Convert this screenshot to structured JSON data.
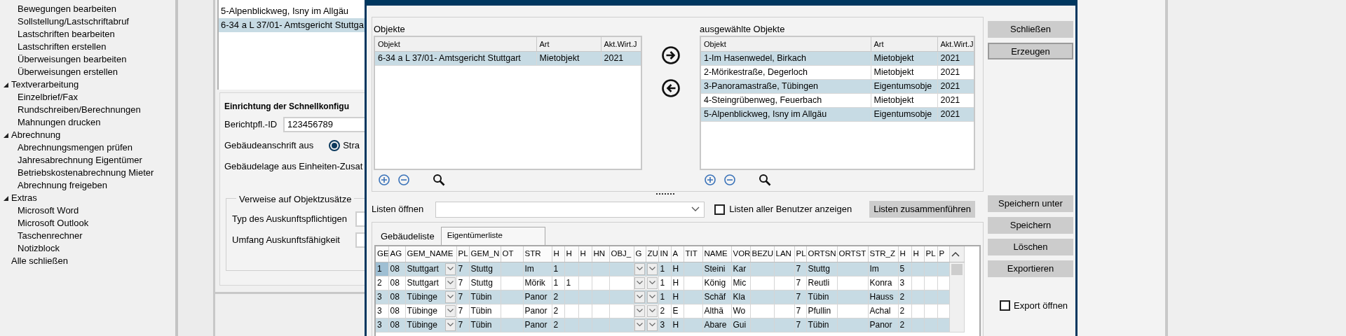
{
  "sidebar": {
    "tree": [
      {
        "children": [
          {
            "label": "Bewegungen bearbeiten"
          },
          {
            "label": "Sollstellung/Lastschriftabruf"
          },
          {
            "label": "Lastschriften bearbeiten"
          },
          {
            "label": "Lastschriften erstellen"
          },
          {
            "label": "Überweisungen bearbeiten"
          },
          {
            "label": "Überweisungen erstellen"
          }
        ]
      },
      {
        "label": "Textverarbeitung",
        "expanded": true,
        "children": [
          {
            "label": "Einzelbrief/Fax"
          },
          {
            "label": "Rundschreiben/Berechnungen"
          },
          {
            "label": "Mahnungen drucken"
          }
        ]
      },
      {
        "label": "Abrechnung",
        "expanded": true,
        "children": [
          {
            "label": "Abrechnungsmengen prüfen"
          },
          {
            "label": "Jahresabrechnung Eigentümer"
          },
          {
            "label": "Betriebskostenabrechnung Mieter"
          },
          {
            "label": "Abrechnung freigeben"
          }
        ]
      },
      {
        "label": "Extras",
        "expanded": true,
        "children": [
          {
            "label": "Microsoft Word"
          },
          {
            "label": "Microsoft Outlook"
          },
          {
            "label": "Taschenrechner"
          },
          {
            "label": "Notizblock"
          }
        ]
      },
      {
        "label": "Alle schließen"
      }
    ]
  },
  "background_window": {
    "list": [
      {
        "text": "5-Alpenblickweg, Isny im Allgäu"
      },
      {
        "text": "6-34 a L 37/01- Amtsgericht Stuttga"
      }
    ],
    "group": {
      "title": "Einrichtung der Schnellkonfigu",
      "fields": [
        {
          "kind": "input",
          "label": "Berichtpfl.-ID",
          "value": "123456789"
        },
        {
          "kind": "radio",
          "label": "Gebäudeanschrift aus",
          "option": "Stra",
          "checked": true
        },
        {
          "kind": "label",
          "label": "Gebäudelage aus Einheiten-Zusat"
        }
      ],
      "fieldset": {
        "legend": "Verweise auf Objektzusätze",
        "fields": [
          {
            "kind": "input",
            "label": "Typ des Auskunftspflichtigen"
          },
          {
            "kind": "input",
            "label": "Umfang Auskunftsfähigkeit"
          }
        ]
      }
    }
  },
  "dialog": {
    "objects": {
      "label": "Objekte",
      "columns": [
        "Objekt",
        "Art",
        "Akt.Wirt.J"
      ],
      "rows": [
        [
          "6-34 a L 37/01- Amtsgericht Stuttgart",
          "Mietobjekt",
          "2021"
        ]
      ]
    },
    "selected_objects": {
      "label": "ausgewählte Objekte",
      "columns": [
        "Objekt",
        "Art",
        "Akt.Wirt.J"
      ],
      "rows": [
        [
          "1-Im Hasenwedel, Birkach",
          "Mietobjekt",
          "2021"
        ],
        [
          "2-Mörikestraße, Degerloch",
          "Mietobjekt",
          "2021"
        ],
        [
          "3-Panoramastraße, Tübingen",
          "Eigentumsobje",
          "2021"
        ],
        [
          "4-Steingrübenweg, Feuerbach",
          "Mietobjekt",
          "2021"
        ],
        [
          "5-Alpenblickweg, Isny im Allgäu",
          "Eigentumsobje",
          "2021"
        ]
      ]
    },
    "side_buttons": [
      {
        "label": "Schließen",
        "default": false
      },
      {
        "label": "Erzeugen",
        "default": true
      }
    ],
    "lists_bar": {
      "label": "Listen öffnen",
      "all_users": {
        "label": "Listen aller Benutzer anzeigen",
        "checked": false
      },
      "merge_button": "Listen zusammenführen"
    },
    "tabs": [
      {
        "label": "Gebäudeliste",
        "selected": false
      },
      {
        "label": "Eigentümerliste",
        "selected": true
      }
    ],
    "grid": {
      "columns": [
        {
          "label": "GE"
        },
        {
          "label": "AG"
        },
        {
          "label": "GEM_NAME",
          "kind": "combo"
        },
        {
          "label": "PL"
        },
        {
          "label": "GEM_N"
        },
        {
          "label": "OT"
        },
        {
          "label": "STR"
        },
        {
          "label": "H"
        },
        {
          "label": "H"
        },
        {
          "label": "H"
        },
        {
          "label": "HN"
        },
        {
          "label": "OBJ_"
        },
        {
          "label": "G",
          "kind": "combo"
        },
        {
          "label": "ZU",
          "kind": "combo"
        },
        {
          "label": "IN"
        },
        {
          "label": "A"
        },
        {
          "label": "TIT"
        },
        {
          "label": "NAME"
        },
        {
          "label": "VOR"
        },
        {
          "label": "BEZU"
        },
        {
          "label": "LAN"
        },
        {
          "label": "PL"
        },
        {
          "label": "ORTSN"
        },
        {
          "label": "ORTST"
        },
        {
          "label": "STR_Z"
        },
        {
          "label": "H"
        },
        {
          "label": "H"
        },
        {
          "label": "PL"
        },
        {
          "label": "P"
        }
      ],
      "rows": [
        {
          "selected": true,
          "cells": [
            "1",
            "08",
            "Stuttgart",
            "7",
            "Stuttg",
            null,
            "Im",
            "1",
            null,
            null,
            null,
            null,
            null,
            null,
            "1",
            "H",
            null,
            "Steini",
            "Kar",
            null,
            null,
            "7",
            "Stuttg",
            null,
            "Im",
            "5",
            null,
            null,
            null
          ]
        },
        {
          "selected": false,
          "cells": [
            "2",
            "08",
            "Stuttgart",
            "7",
            "Stuttg",
            null,
            "Mörik",
            "1",
            "1",
            null,
            null,
            null,
            null,
            null,
            "1",
            "H",
            null,
            "König",
            "Mic",
            null,
            null,
            "7",
            "Reutli",
            null,
            "Konra",
            "3",
            null,
            null,
            null
          ]
        },
        {
          "selected": false,
          "cells": [
            "3",
            "08",
            "Tübinge",
            "7",
            "Tübin",
            null,
            "Panor",
            "2",
            null,
            null,
            null,
            null,
            null,
            null,
            "1",
            "H",
            null,
            "Schäf",
            "Kla",
            null,
            null,
            "7",
            "Tübin",
            null,
            "Hauss",
            "2",
            null,
            null,
            null
          ]
        },
        {
          "selected": false,
          "cells": [
            "3",
            "08",
            "Tübinge",
            "7",
            "Tübin",
            null,
            "Panor",
            "2",
            null,
            null,
            null,
            null,
            null,
            null,
            "2",
            "E",
            null,
            "Althä",
            "Wo",
            null,
            null,
            "7",
            "Pfullin",
            null,
            "Achal",
            "2",
            null,
            null,
            null
          ]
        },
        {
          "selected": false,
          "cells": [
            "3",
            "08",
            "Tübinge",
            "7",
            "Tübin",
            null,
            "Panor",
            "2",
            null,
            null,
            null,
            null,
            null,
            null,
            "3",
            "H",
            null,
            "Abare",
            "Gui",
            null,
            null,
            "7",
            "Tübin",
            null,
            "Panor",
            "2",
            null,
            null,
            null
          ]
        }
      ]
    },
    "action_buttons": [
      "Speichern unter",
      "Speichern",
      "Löschen",
      "Exportieren"
    ],
    "export_open": {
      "label": "Export öffnen",
      "checked": false
    }
  }
}
